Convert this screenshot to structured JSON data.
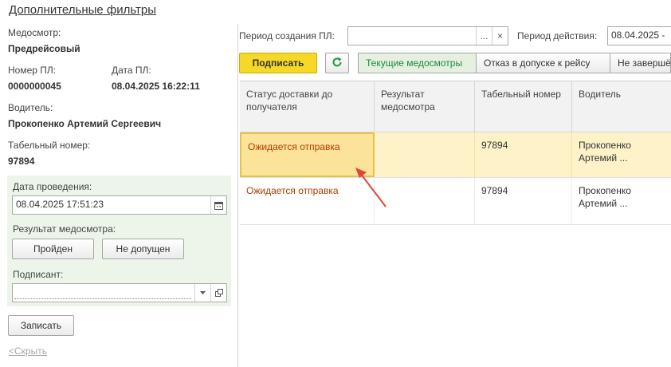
{
  "filters_link": "Дополнительные фильтры",
  "medosmotr": {
    "label": "Медосмотр:",
    "value": "Предрейсовый"
  },
  "nomer_pl": {
    "label": "Номер ПЛ:",
    "value": "0000000045"
  },
  "data_pl": {
    "label": "Дата ПЛ:",
    "value": "08.04.2025 16:22:11"
  },
  "driver": {
    "label": "Водитель:",
    "value": "Прокопенко Артемий Сергеевич"
  },
  "tab_number": {
    "label": "Табельный номер:",
    "value": "97894"
  },
  "exam_date": {
    "label": "Дата проведения:",
    "value": "08.04.2025 17:51:23"
  },
  "result": {
    "label": "Результат медосмотра:",
    "passed_button": "Пройден",
    "failed_button": "Не допущен"
  },
  "signer": {
    "label": "Подписант:",
    "value": ""
  },
  "save_button": "Записать",
  "hide_link": "<Скрыть",
  "period_created": {
    "label": "Период создания ПЛ:",
    "value": "",
    "select_button": "...",
    "clear_button": "×"
  },
  "period_action": {
    "label": "Период действия:",
    "value": "08.04.2025 -"
  },
  "toolbar": {
    "sign_button": "Подписать",
    "tabs": [
      "Текущие медосмотры",
      "Отказ в допуске к рейсу",
      "Не завершё"
    ]
  },
  "table": {
    "columns": [
      "Статус доставки до получателя",
      "Результат медосмотра",
      "Табельный номер",
      "Водитель"
    ],
    "rows": [
      {
        "status": "Ожидается отправка",
        "result": "",
        "tab": "97894",
        "driver": "Прокопенко Артемий ..."
      },
      {
        "status": "Ожидается отправка",
        "result": "",
        "tab": "97894",
        "driver": "Прокопенко Артемий ..."
      }
    ]
  },
  "colors": {
    "accent_yellow": "#f6d826",
    "status_text": "#b23c00",
    "active_tab_text": "#1b8a3a",
    "panel_green": "#edf5ea",
    "selection_arrow": "#e0443a"
  }
}
